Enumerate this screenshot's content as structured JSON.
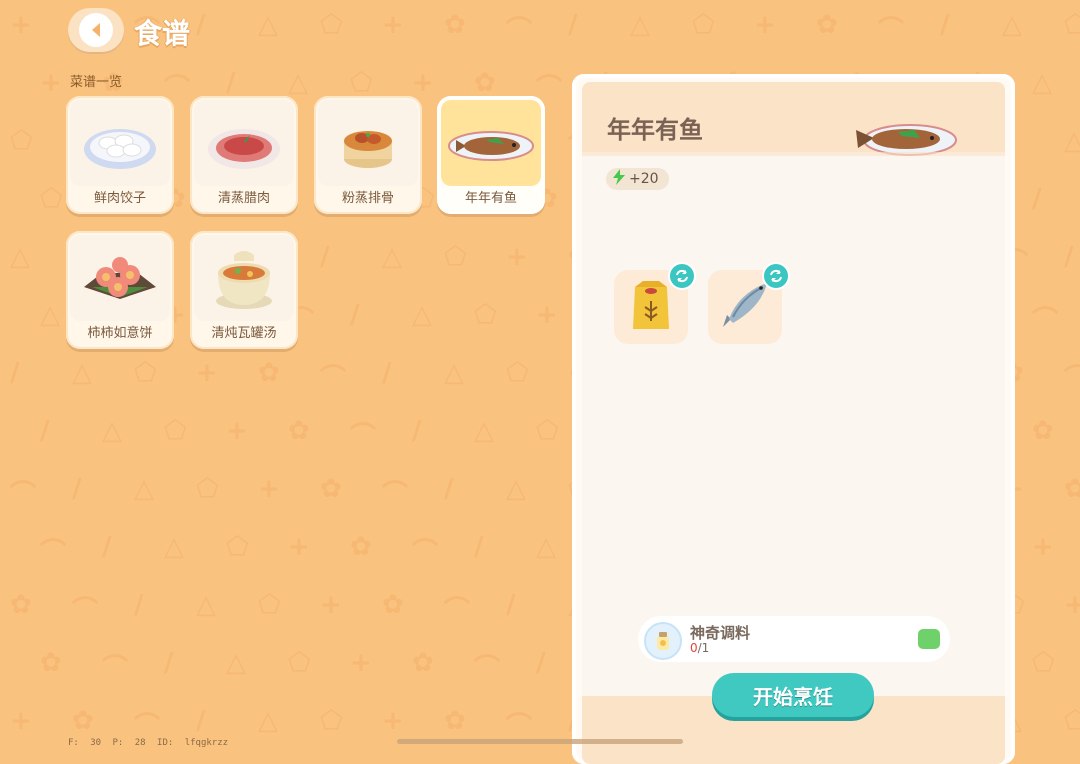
{
  "header": {
    "title": "食谱",
    "back_icon": "chevron-left-icon"
  },
  "recipe_list": {
    "heading": "菜谱一览",
    "items": [
      {
        "label": "鲜肉饺子",
        "icon": "dumplings-icon"
      },
      {
        "label": "清蒸腊肉",
        "icon": "steamed-cured-meat-icon"
      },
      {
        "label": "粉蒸排骨",
        "icon": "steamed-ribs-icon"
      },
      {
        "label": "年年有鱼",
        "icon": "fish-dish-icon",
        "selected": true
      },
      {
        "label": "柿柿如意饼",
        "icon": "persimmon-cake-icon"
      },
      {
        "label": "清炖瓦罐汤",
        "icon": "clay-pot-soup-icon"
      }
    ]
  },
  "detail": {
    "dish_name": "年年有鱼",
    "energy": "+20",
    "energy_icon": "lightning-icon",
    "ingredients": [
      {
        "icon": "flour-bag-icon",
        "swap_icon": "swap-icon"
      },
      {
        "icon": "fish-icon",
        "swap_icon": "swap-icon"
      }
    ],
    "seasoning": {
      "name": "神奇调料",
      "count_have": "0",
      "count_need": "/1",
      "icon": "seasoning-jar-icon"
    },
    "cook_button": "开始烹饪"
  },
  "debug": "F: 30   P: 28   ID: lfqgkrzz",
  "colors": {
    "background": "#f9c27e",
    "accent": "#3fc9c1",
    "panel": "#fbf6ef"
  }
}
